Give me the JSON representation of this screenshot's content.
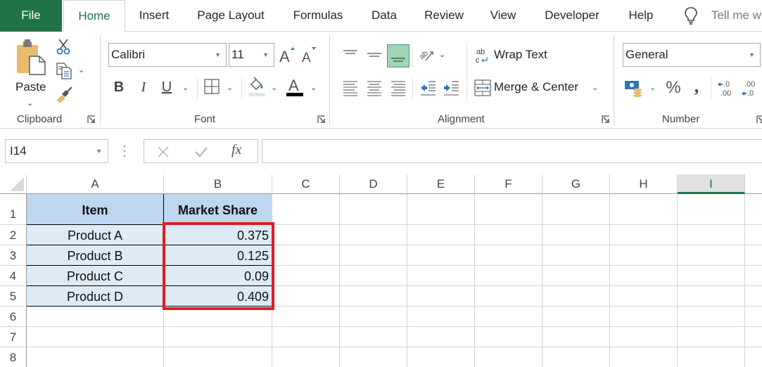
{
  "tabs": {
    "file": "File",
    "home": "Home",
    "insert": "Insert",
    "page_layout": "Page Layout",
    "formulas": "Formulas",
    "data": "Data",
    "review": "Review",
    "view": "View",
    "developer": "Developer",
    "help": "Help",
    "tell_me": "Tell me w"
  },
  "ribbon": {
    "clipboard": {
      "label": "Clipboard",
      "paste_label": "Paste"
    },
    "font": {
      "label": "Font",
      "font_name": "Calibri",
      "font_size": "11",
      "bold": "B",
      "italic": "I",
      "underline": "U",
      "font_color": "#000000",
      "fill_color": "#dce9f5"
    },
    "alignment": {
      "label": "Alignment",
      "wrap_text": "Wrap Text",
      "merge_center": "Merge & Center",
      "active_vertical": "bottom-align"
    },
    "number": {
      "label": "Number",
      "format": "General",
      "percent": "%",
      "comma": ",",
      "increase_decimal": ".0 / .00",
      "decrease_decimal": ".00 / .0"
    }
  },
  "formula_bar": {
    "name_box": "I14",
    "fx": "fx",
    "value": ""
  },
  "sheet": {
    "columns": [
      "A",
      "B",
      "C",
      "D",
      "E",
      "F",
      "G",
      "H",
      "I"
    ],
    "selected_column": "I",
    "rows": [
      "1",
      "2",
      "3",
      "4",
      "5",
      "6",
      "7",
      "8"
    ],
    "table": {
      "headers": [
        "Item",
        "Market Share"
      ],
      "rows": [
        [
          "Product A",
          "0.375"
        ],
        [
          "Product B",
          "0.125"
        ],
        [
          "Product C",
          "0.09"
        ],
        [
          "Product D",
          "0.409"
        ]
      ]
    }
  },
  "colors": {
    "excel_green": "#217346",
    "header_fill": "#bdd7ee",
    "body_fill": "#ddebf7",
    "highlight_border": "#e31b23"
  }
}
